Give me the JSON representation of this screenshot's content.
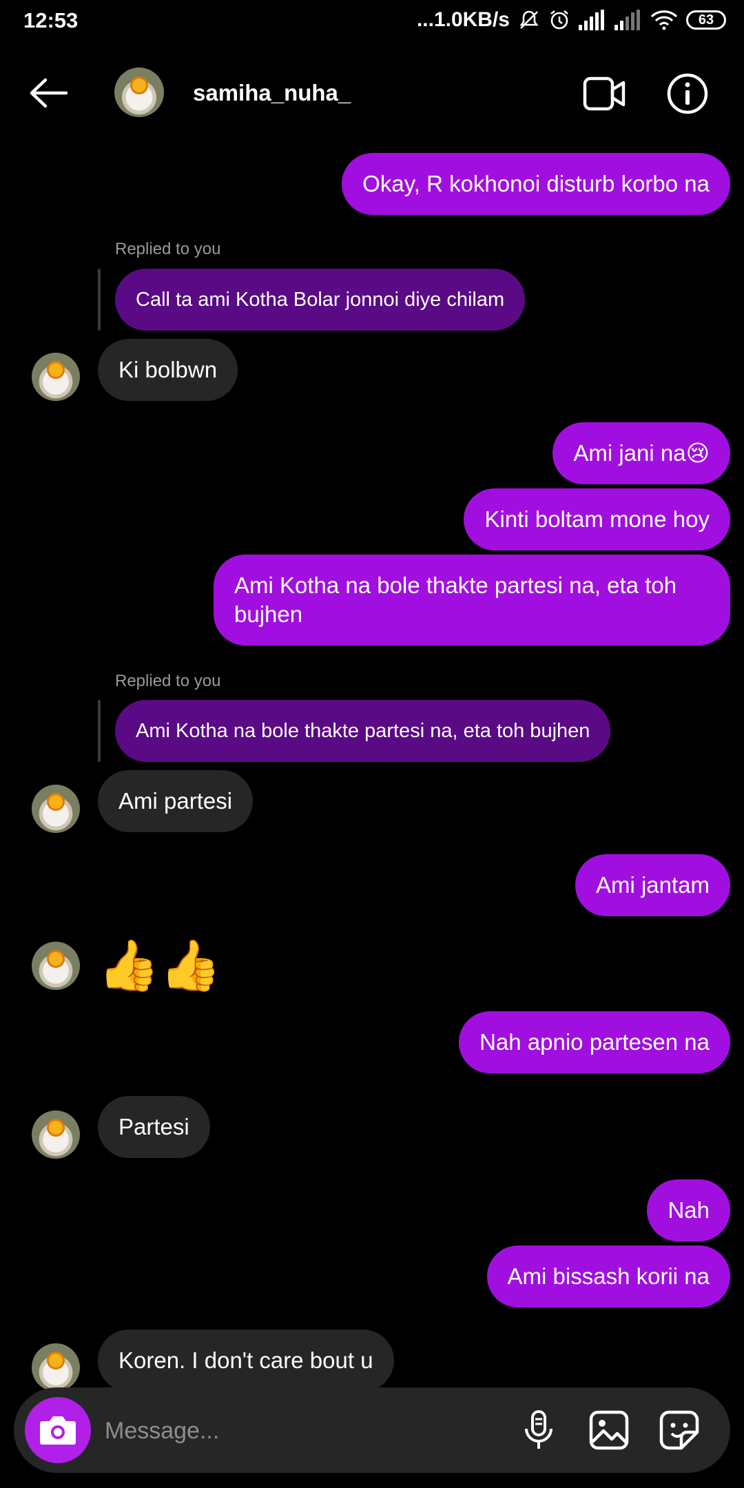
{
  "status_bar": {
    "time": "12:53",
    "network_speed": "...1.0KB/s",
    "battery": "63",
    "icons": [
      "mute-icon",
      "alarm-icon",
      "signal-icon",
      "signal-icon",
      "wifi-icon",
      "battery-icon"
    ]
  },
  "header": {
    "username": "samiha_nuha_",
    "icons": [
      "back-arrow-icon",
      "video-call-icon",
      "info-icon"
    ]
  },
  "replied_label": "Replied to you",
  "messages": {
    "m1": "Okay, R kokhonoi disturb korbo na",
    "r1": "Call ta ami Kotha Bolar jonnoi diye chilam",
    "m2": "Ki bolbwn",
    "m3": "Ami jani na😢",
    "m4": "Kinti boltam mone hoy",
    "m5_line1": "Ami Kotha na bole thakte partesi na, eta toh",
    "m5_line2": "bujhen",
    "r2": "Ami Kotha na bole thakte partesi na, eta toh bujhen",
    "m6": "Ami partesi",
    "m7": "Ami jantam",
    "m8": "👍👍",
    "m9": "Nah apnio partesen na",
    "m10": "Partesi",
    "m11": "Nah",
    "m12": "Ami bissash korii na",
    "m13": "Koren. I don't care bout u"
  },
  "composer": {
    "placeholder": "Message...",
    "icons": [
      "camera-icon",
      "microphone-icon",
      "gallery-icon",
      "sticker-icon"
    ]
  },
  "colors": {
    "outgoing_bubble": "#a10fe0",
    "incoming_bubble": "#262626",
    "reply_bubble": "#5a0a85",
    "background": "#000000"
  }
}
